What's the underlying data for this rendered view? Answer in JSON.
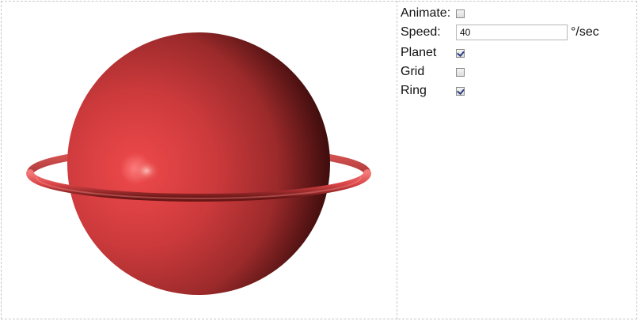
{
  "controls": {
    "animate": {
      "label": "Animate:",
      "checked": false
    },
    "speed": {
      "label": "Speed:",
      "value": "40",
      "unit": "°/sec"
    },
    "planet": {
      "label": "Planet",
      "checked": true
    },
    "grid": {
      "label": "Grid",
      "checked": false
    },
    "ring": {
      "label": "Ring",
      "checked": true
    }
  },
  "scene": {
    "planet_color": "#c8383a",
    "ring_color": "#d84a4c",
    "planet_visible": true,
    "ring_visible": true,
    "grid_visible": false
  }
}
